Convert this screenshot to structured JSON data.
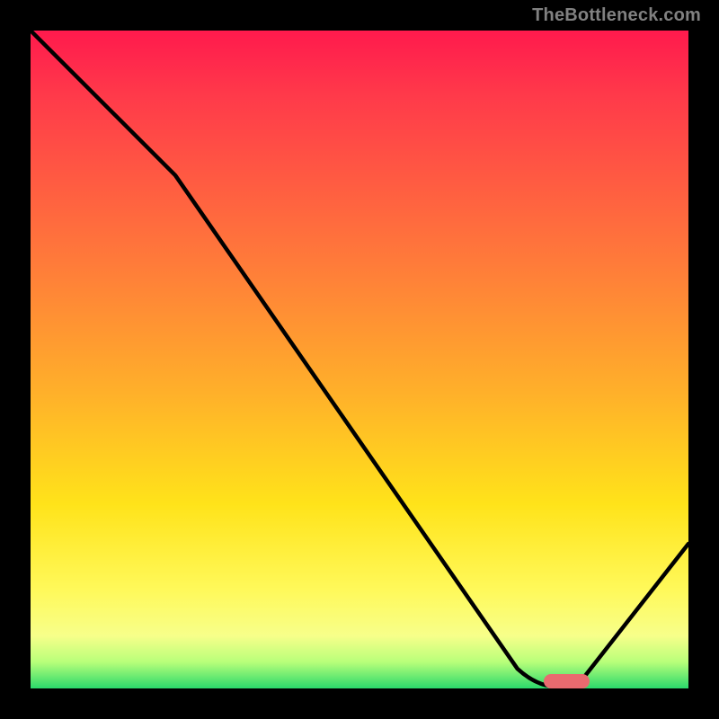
{
  "watermark": {
    "text": "TheBottleneck.com"
  },
  "chart_data": {
    "type": "line",
    "title": "",
    "xlabel": "",
    "ylabel": "",
    "xlim": [
      0,
      100
    ],
    "ylim": [
      0,
      100
    ],
    "grid": false,
    "legend": false,
    "series": [
      {
        "name": "bottleneck-curve",
        "x": [
          0,
          22,
          74,
          80,
          83,
          100
        ],
        "values": [
          100,
          78,
          3,
          0,
          0,
          22
        ]
      }
    ],
    "marker": {
      "name": "optimal-range",
      "x_start": 78,
      "x_end": 85,
      "y": 0.5,
      "color": "#e96a6f"
    },
    "background_gradient": {
      "top": "#ff1a4d",
      "mid_upper": "#ff7a3a",
      "mid": "#ffe31a",
      "mid_lower": "#f7ff8a",
      "bottom": "#2bd96b"
    }
  }
}
